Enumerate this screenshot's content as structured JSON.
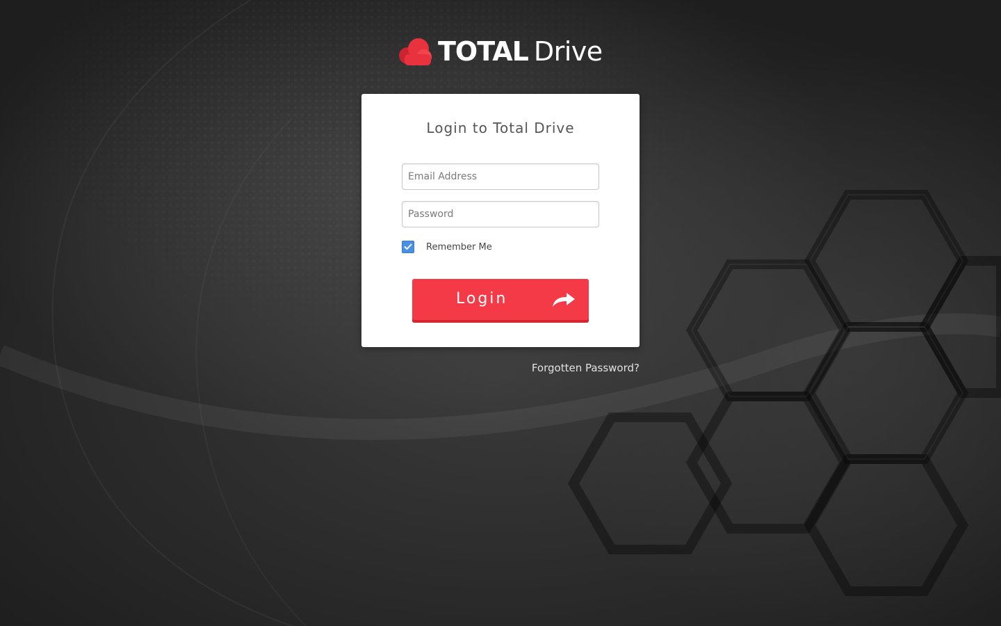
{
  "logo": {
    "brand_bold": "TOTAL",
    "brand_light": "Drive"
  },
  "login_card": {
    "title": "Login to Total Drive",
    "email_placeholder": "Email Address",
    "password_placeholder": "Password",
    "remember_label": "Remember Me",
    "remember_checked": true,
    "login_label": "Login"
  },
  "forgot_link": "Forgotten Password?",
  "icons": {
    "logo": "cloud-icon",
    "checkbox": "checkmark-icon",
    "login": "share-arrow-icon"
  },
  "colors": {
    "accent": "#f43a46",
    "logo_red": "#e8323e",
    "checkbox": "#4a90e2",
    "background": "#2a2a2a"
  }
}
